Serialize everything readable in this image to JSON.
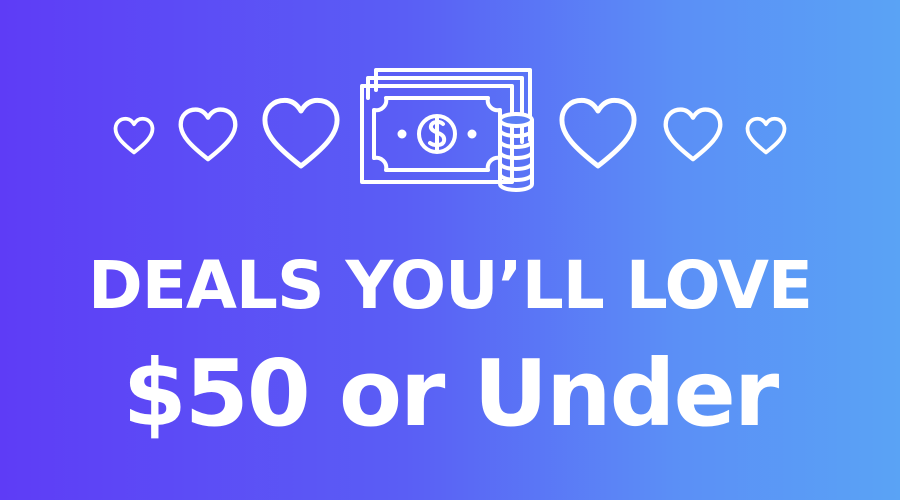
{
  "banner": {
    "headline": "DEALS YOU’LL LOVE",
    "subheadline": "$50 or Under",
    "colors": {
      "gradient_start": "#5e3cf6",
      "gradient_end": "#5aa3f5",
      "foreground": "#ffffff"
    }
  },
  "icons": [
    "heart-outline-icon",
    "heart-outline-icon",
    "heart-outline-icon",
    "money-bill-with-coins-icon",
    "heart-outline-icon",
    "heart-outline-icon",
    "heart-outline-icon"
  ]
}
